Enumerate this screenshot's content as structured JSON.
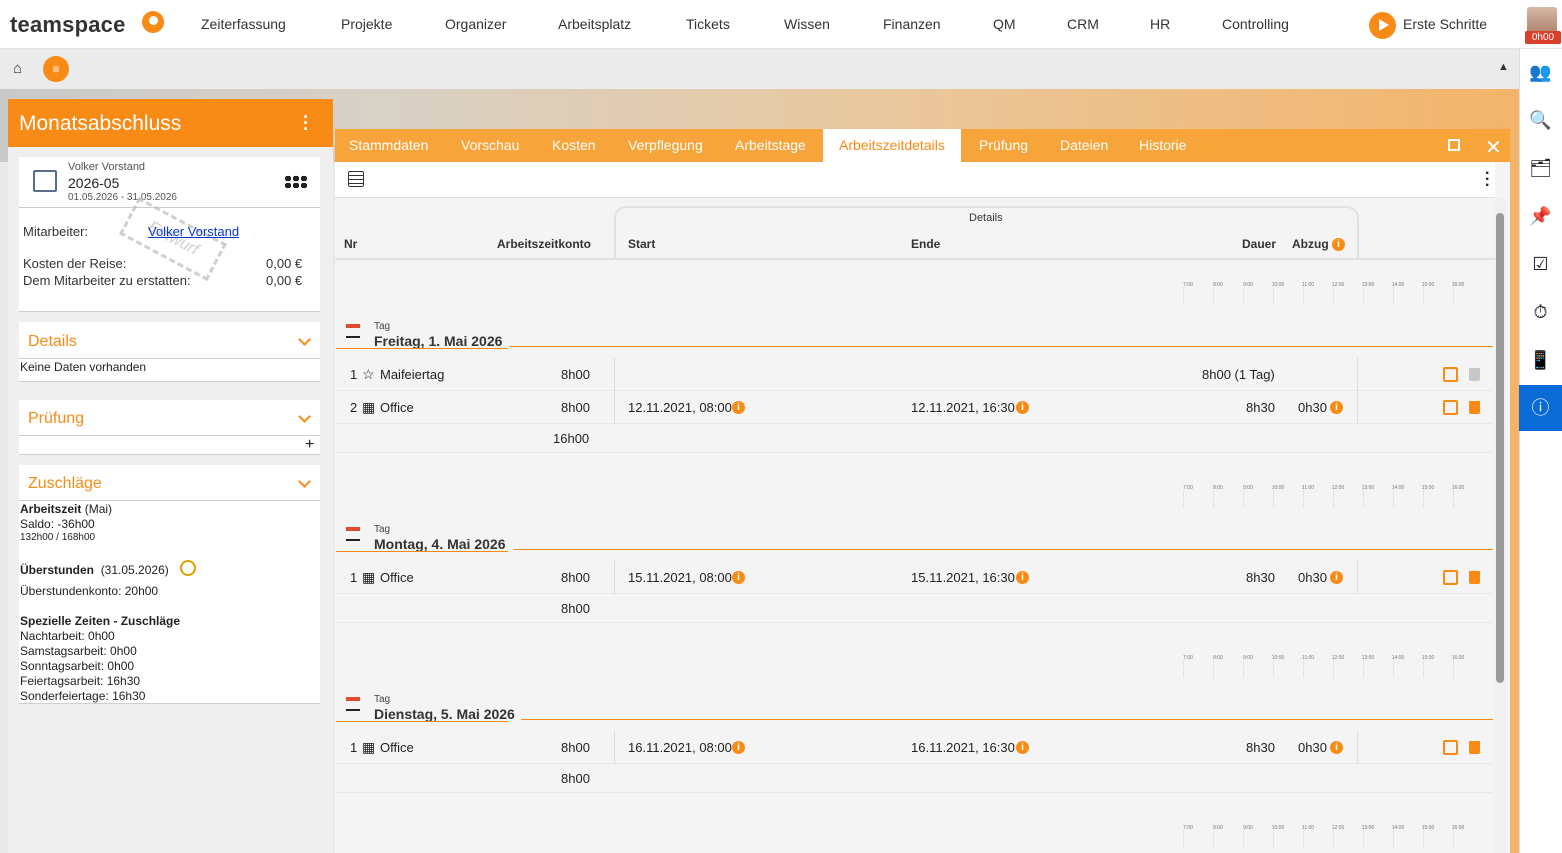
{
  "app": {
    "logo": "teamspace"
  },
  "nav": {
    "items": [
      "Zeiterfassung",
      "Projekte",
      "Organizer",
      "Arbeitsplatz",
      "Tickets",
      "Wissen",
      "Finanzen",
      "QM",
      "CRM",
      "HR",
      "Controlling"
    ],
    "erste_schritte": "Erste Schritte",
    "avatar_badge": "0h00"
  },
  "left": {
    "title": "Monatsabschluss",
    "card": {
      "name": "Volker Vorstand",
      "period": "2026-05",
      "range": "01.05.2026 - 31.05.2026",
      "mitarbeiter_label": "Mitarbeiter:",
      "mitarbeiter_link": "Volker Vorstand",
      "stamp": "Entwurf",
      "kosten_label": "Kosten der Reise:",
      "kosten_value": "0,00 €",
      "erstatten_label": "Dem Mitarbeiter zu erstatten:",
      "erstatten_value": "0,00 €"
    },
    "details": {
      "title": "Details",
      "empty": "Keine Daten vorhanden"
    },
    "pruefung": {
      "title": "Prüfung",
      "add": "+"
    },
    "zuschlaege": {
      "title": "Zuschläge",
      "arbeitszeit_bold": "Arbeitszeit",
      "arbeitszeit_suffix": "(Mai)",
      "saldo": "Saldo: -36h00",
      "hours": "132h00 / 168h00",
      "ueberstunden_bold": "Überstunden",
      "ueberstunden_date": "(31.05.2026)",
      "ueberstundenkonto": "Überstundenkonto: 20h00",
      "spezielle_title": "Spezielle Zeiten - Zuschläge",
      "lines": [
        "Nachtarbeit: 0h00",
        "Samstagsarbeit: 0h00",
        "Sonntagsarbeit: 0h00",
        "Feiertagsarbeit: 16h30",
        "Sonderfeiertage: 16h30"
      ]
    }
  },
  "tabs": [
    "Stammdaten",
    "Vorschau",
    "Kosten",
    "Verpflegung",
    "Arbeitstage",
    "Arbeitszeitdetails",
    "Prüfung",
    "Dateien",
    "Historie"
  ],
  "active_tab": "Arbeitszeitdetails",
  "table": {
    "group_label": "Details",
    "headers": {
      "nr": "Nr",
      "konto": "Arbeitszeitkonto",
      "start": "Start",
      "ende": "Ende",
      "dauer": "Dauer",
      "abzug": "Abzug"
    },
    "timeline_ticks": [
      "7:00",
      "8:00",
      "9:00",
      "10:00",
      "11:00",
      "12:00",
      "13:00",
      "14:00",
      "15:00",
      "16:00"
    ]
  },
  "days": [
    {
      "tag": "Tag",
      "date": "Freitag, 1. Mai 2026",
      "total": "16h00",
      "rows": [
        {
          "nr": "1",
          "icon": "star-icon",
          "glyph": "☆",
          "label": "Maifeiertag",
          "konto": "8h00",
          "start": "",
          "ende": "",
          "dauer": "8h00 (1 Tag)",
          "abzug": ""
        },
        {
          "nr": "2",
          "icon": "office-icon",
          "glyph": "▦",
          "label": "Office",
          "konto": "8h00",
          "start": "12.11.2021, 08:00",
          "ende": "12.11.2021, 16:30",
          "dauer": "8h30",
          "abzug": "0h30"
        }
      ]
    },
    {
      "tag": "Tag",
      "date": "Montag, 4. Mai 2026",
      "total": "8h00",
      "rows": [
        {
          "nr": "1",
          "icon": "office-icon",
          "glyph": "▦",
          "label": "Office",
          "konto": "8h00",
          "start": "15.11.2021, 08:00",
          "ende": "15.11.2021, 16:30",
          "dauer": "8h30",
          "abzug": "0h30"
        }
      ]
    },
    {
      "tag": "Tag",
      "date": "Dienstag, 5. Mai 2026",
      "total": "8h00",
      "rows": [
        {
          "nr": "1",
          "icon": "office-icon",
          "glyph": "▦",
          "label": "Office",
          "konto": "8h00",
          "start": "16.11.2021, 08:00",
          "ende": "16.11.2021, 16:30",
          "dauer": "8h30",
          "abzug": "0h30"
        }
      ]
    }
  ],
  "right_sidebar": [
    "people-icon",
    "search-icon",
    "inbox-icon",
    "pin-icon",
    "tasks-icon",
    "timer-icon",
    "phone-icon",
    "info-icon"
  ],
  "colors": {
    "accent": "#f78b16",
    "tab_bar": "#f7a43a",
    "info_active": "#0a6ad6"
  }
}
